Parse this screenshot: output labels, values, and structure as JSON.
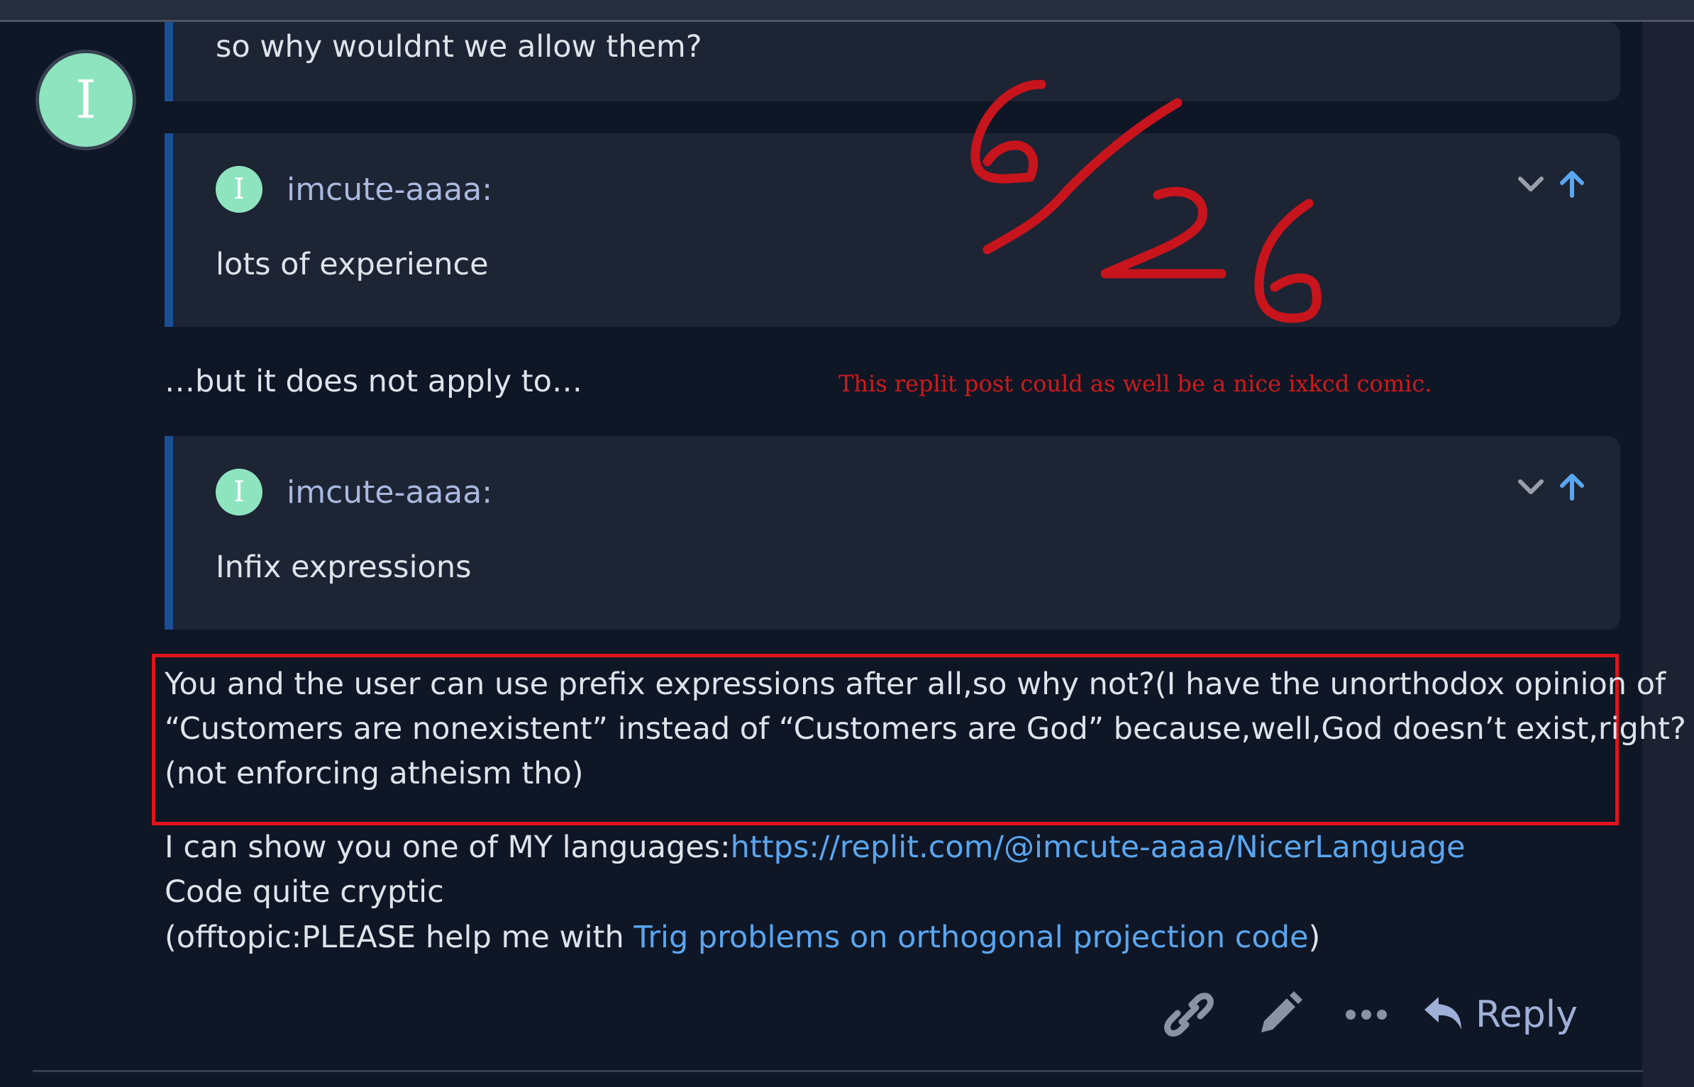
{
  "post": {
    "avatar_letter": "I",
    "top_quote_text": "so why wouldnt we allow them?",
    "quotes": [
      {
        "author": "imcute-aaaa:",
        "avatar_letter": "I",
        "text": "lots of experience",
        "controls": [
          "chevron-down-icon",
          "arrow-up-icon"
        ]
      },
      {
        "author": "imcute-aaaa:",
        "avatar_letter": "I",
        "text": "Infix expressions",
        "controls": [
          "chevron-down-icon",
          "arrow-up-icon"
        ]
      }
    ],
    "between_text": "…but it does not apply to…",
    "highlighted_paragraph": [
      "You and the user can use prefix expressions after all,so why not?(I have the unorthodox opinion of",
      "“Customers are nonexistent” instead of “Customers are God” because,well,God doesn’t exist,right?",
      "(not enforcing atheism tho)"
    ],
    "languages_line": {
      "prefix": "I can show you one of MY languages:",
      "link": "https://replit.com/@imcute-aaaa/NicerLanguage"
    },
    "cryptic_line": "Code quite cryptic",
    "offtopic_line": {
      "prefix": "(offtopic:PLEASE help me with ",
      "link": "Trig problems on orthogonal projection code",
      "suffix": ")"
    }
  },
  "annotations": {
    "handwritten_score": "6/26",
    "comment": "This replit post could as well be a nice ixkcd comic.",
    "ink_color": "#c8141c"
  },
  "actions": {
    "icons": [
      "link-icon",
      "pencil-icon",
      "more-icon",
      "reply-icon"
    ],
    "reply_label": "Reply"
  },
  "colors": {
    "background": "#0f1626",
    "quote_background": "#1d2434",
    "quote_border": "#1b4f94",
    "link": "#5aa6ef",
    "avatar": "#8ee4bf",
    "highlight_border": "#e0141b"
  }
}
